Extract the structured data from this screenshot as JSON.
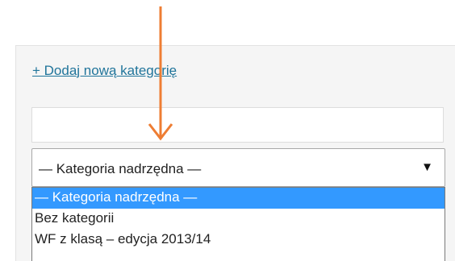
{
  "category_panel": {
    "add_link_label": "+ Dodaj nową kategorię",
    "name_input": {
      "value": "",
      "placeholder": ""
    },
    "parent_select": {
      "selected_label": "— Kategoria nadrzędna —",
      "arrow_glyph": "▼",
      "options": [
        {
          "label": "— Kategoria nadrzędna —",
          "highlighted": true
        },
        {
          "label": "Bez kategorii",
          "highlighted": false
        },
        {
          "label": "WF z klasą – edycja 2013/14",
          "highlighted": false
        }
      ]
    }
  },
  "colors": {
    "link": "#21759b",
    "highlight": "#3399ff",
    "annotation_arrow": "#ee7d33"
  }
}
